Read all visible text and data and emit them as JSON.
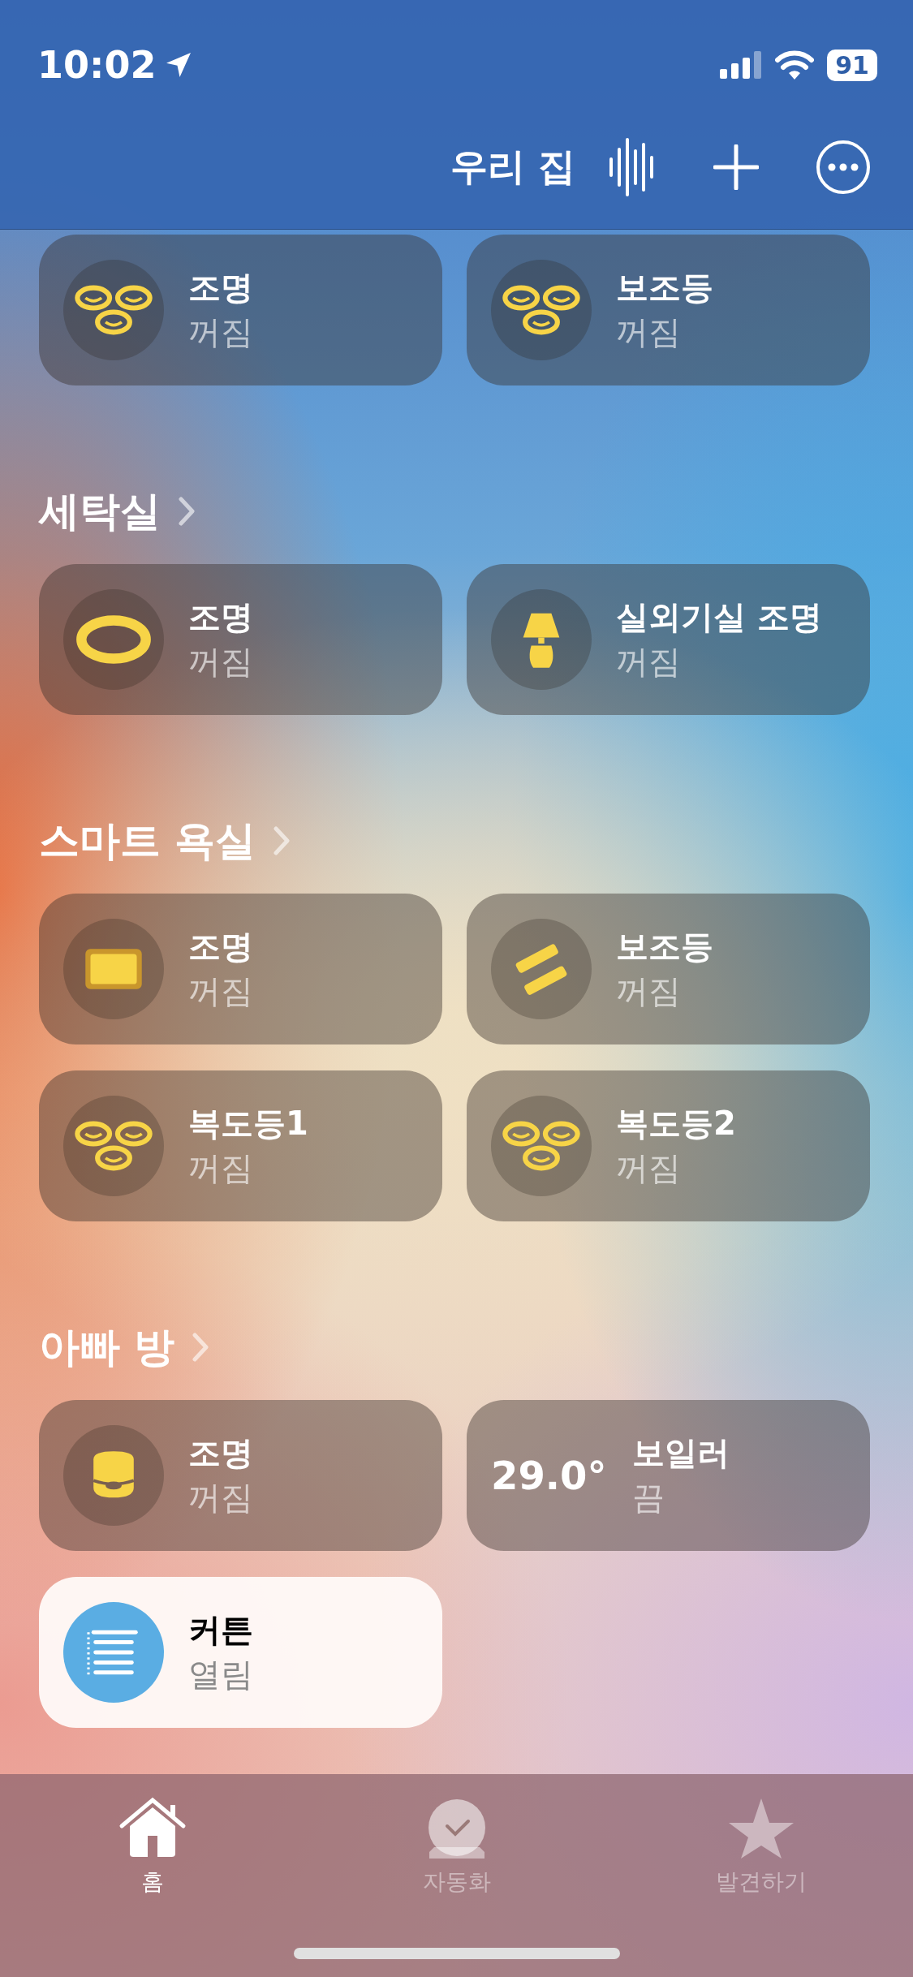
{
  "status_bar": {
    "time": "10:02",
    "battery": "91"
  },
  "header": {
    "title": "우리 집"
  },
  "sections": [
    {
      "tiles": [
        {
          "name": "조명",
          "status": "꺼짐",
          "kind": "trio",
          "on": false
        },
        {
          "name": "보조등",
          "status": "꺼짐",
          "kind": "trio",
          "on": false
        }
      ]
    },
    {
      "title": "세탁실",
      "tiles": [
        {
          "name": "조명",
          "status": "꺼짐",
          "kind": "ring",
          "on": false
        },
        {
          "name": "실외기실 조명",
          "status": "꺼짐",
          "kind": "lamp",
          "on": false
        }
      ]
    },
    {
      "title": "스마트 욕실",
      "tiles": [
        {
          "name": "조명",
          "status": "꺼짐",
          "kind": "panel",
          "on": false
        },
        {
          "name": "보조등",
          "status": "꺼짐",
          "kind": "strip",
          "on": false
        },
        {
          "name": "복도등1",
          "status": "꺼짐",
          "kind": "trio",
          "on": false
        },
        {
          "name": "복도등2",
          "status": "꺼짐",
          "kind": "trio",
          "on": false
        }
      ]
    },
    {
      "title": "아빠 방",
      "tiles": [
        {
          "name": "조명",
          "status": "꺼짐",
          "kind": "puck",
          "on": false
        },
        {
          "name": "보일러",
          "status": "끔",
          "kind": "thermostat",
          "reading": "29.0°",
          "on": false
        },
        {
          "name": "커튼",
          "status": "열림",
          "kind": "curtain",
          "on": true
        }
      ]
    }
  ],
  "tab_bar": [
    {
      "label": "홈",
      "kind": "home",
      "selected": true
    },
    {
      "label": "자동화",
      "kind": "automation",
      "selected": false
    },
    {
      "label": "발견하기",
      "kind": "discover",
      "selected": false
    }
  ]
}
